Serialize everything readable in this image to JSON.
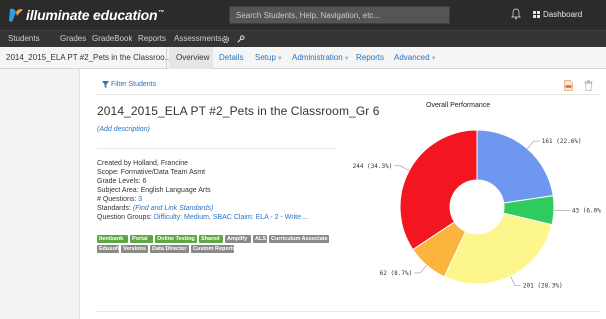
{
  "brand": {
    "name": "illuminate education",
    "tm": "™"
  },
  "search": {
    "placeholder": "Search Students, Help, Navigation, etc..."
  },
  "header": {
    "dashboard_label": "Dashboard"
  },
  "nav": [
    "Students",
    "Grades",
    "GradeBook",
    "Reports",
    "Assessments"
  ],
  "breadcrumb": "2014_2015_ELA PT #2_Pets in the Classroo...",
  "tabs": [
    {
      "label": "Overview",
      "active": true,
      "dropdown": false
    },
    {
      "label": "Details",
      "active": false,
      "dropdown": false
    },
    {
      "label": "Setup",
      "active": false,
      "dropdown": true
    },
    {
      "label": "Administration",
      "active": false,
      "dropdown": true
    },
    {
      "label": "Reports",
      "active": false,
      "dropdown": false
    },
    {
      "label": "Advanced",
      "active": false,
      "dropdown": true
    }
  ],
  "filter_label": "Filter Students",
  "assessment": {
    "title": "2014_2015_ELA PT #2_Pets in the Classroom_Gr 6",
    "add_description": "(Add description)",
    "created_by": "Created by Holland, Francine",
    "scope": "Scope: Formative/Data Team Asmt",
    "grade_levels": "Grade Levels: 6",
    "subject_area": "Subject Area: English Language Arts",
    "questions_label": "# Questions:",
    "questions_value": "3",
    "standards_label": "Standards:",
    "standards_link": "(Find and Link Standards)",
    "question_groups_label": "Question Groups:",
    "question_groups_value": "Difficulty: Medium, SBAC Claim: ELA - 2 - Write ..."
  },
  "tags": [
    {
      "label": "Itembank",
      "color": "green"
    },
    {
      "label": "Portal",
      "color": "green"
    },
    {
      "label": "Online Testing",
      "color": "green"
    },
    {
      "label": "Shared",
      "color": "green"
    },
    {
      "label": "Amplify",
      "color": "gray"
    },
    {
      "label": "ALS",
      "color": "gray"
    },
    {
      "label": "Curriculum Associate",
      "color": "gray"
    },
    {
      "label": "Edusoft",
      "color": "gray"
    },
    {
      "label": "Versions",
      "color": "gray"
    },
    {
      "label": "Data Director",
      "color": "gray"
    },
    {
      "label": "Custom Reports",
      "color": "gray"
    }
  ],
  "colors": {
    "topbar": "#2b2b2b",
    "link": "#2a74c0",
    "tag_green": "#5fa744",
    "tag_gray": "#8a8a8a"
  },
  "chart_data": {
    "type": "pie",
    "title": "Overall Performance",
    "donut": true,
    "slices": [
      {
        "value": 161,
        "percent": 22.6,
        "label": "161 (22.6%)",
        "color": "#6e97ef"
      },
      {
        "value": 43,
        "percent": 6.0,
        "label": "43 (6.0%)",
        "color": "#2ecc5c"
      },
      {
        "value": 201,
        "percent": 28.3,
        "label": "201 (28.3%)",
        "color": "#fdf68c"
      },
      {
        "value": 62,
        "percent": 8.7,
        "label": "62 (8.7%)",
        "color": "#fbb53f"
      },
      {
        "value": 244,
        "percent": 34.3,
        "label": "244 (34.3%)",
        "color": "#f3151f"
      }
    ]
  }
}
